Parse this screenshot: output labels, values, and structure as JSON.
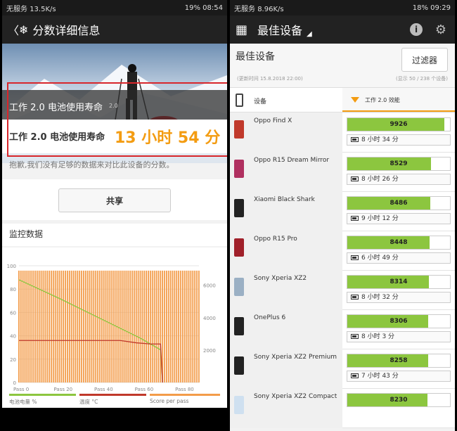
{
  "left": {
    "status": {
      "carrier": "无服务 ",
      "speed": "13.5K/s",
      "battery": "19%",
      "time": "08:54"
    },
    "appbar": {
      "back": "〈",
      "title": "分数详细信息"
    },
    "band1": {
      "label": "工作 2.0 电池使用寿命",
      "version": "2.0"
    },
    "band2": {
      "label": "工作 2.0 电池使用寿命",
      "value": "13 小时 54 分"
    },
    "sorry": "抱歉,我们没有足够的数据来对比此设备的分数。",
    "share_label": "共享",
    "monitor_title": "监控数据",
    "legend": [
      "电池电量 %",
      "温度 °C",
      "Score per pass"
    ]
  },
  "chart_data": {
    "type": "line",
    "title": "",
    "x_ticks": [
      "Pass 0",
      "Pass 20",
      "Pass 40",
      "Pass 60",
      "Pass 80"
    ],
    "y_left_ticks": [
      100,
      80,
      60,
      40,
      20,
      0
    ],
    "y_right_ticks": [
      6000,
      4000,
      2000
    ],
    "ylim_left": [
      0,
      100
    ],
    "ylim_right": [
      0,
      7200
    ],
    "xlim": [
      0,
      89
    ],
    "series": [
      {
        "name": "电池电量 %",
        "color": "#8cc63f",
        "values": [
          [
            0,
            88
          ],
          [
            20,
            72
          ],
          [
            40,
            55
          ],
          [
            60,
            38
          ],
          [
            70,
            28
          ],
          [
            71,
            0
          ]
        ]
      },
      {
        "name": "温度 °C",
        "color": "#c0392b",
        "values": [
          [
            0,
            36
          ],
          [
            20,
            36
          ],
          [
            30,
            36
          ],
          [
            40,
            36
          ],
          [
            50,
            36
          ],
          [
            58,
            34
          ],
          [
            65,
            33
          ],
          [
            70,
            33
          ],
          [
            71,
            0
          ]
        ]
      },
      {
        "name": "Score per pass",
        "color": "#f39c4a",
        "values": [
          [
            0,
            6900
          ],
          [
            89,
            6900
          ]
        ]
      }
    ],
    "grid": true
  },
  "right": {
    "status": {
      "carrier": "无服务 ",
      "speed": "8.96K/s",
      "battery": "18%",
      "time": "09:29"
    },
    "appbar": {
      "title": "最佳设备"
    },
    "section_title": "最佳设备",
    "updated": "(更新时间 15.8.2018 22:00)",
    "count": "(显示 50 / 238 个设备)",
    "filter_label": "过滤器",
    "col_device": "设备",
    "col_score": "工作 2.0 效能",
    "devices": [
      {
        "name": "Oppo Find X",
        "score": 9926,
        "score_text": "9926",
        "life": "8 小时 34 分",
        "color": "#c0392b"
      },
      {
        "name": "Oppo R15 Dream Mirror",
        "score": 8529,
        "score_text": "8529",
        "life": "8 小时 26 分",
        "color": "#b03060"
      },
      {
        "name": "Xiaomi Black Shark",
        "score": 8486,
        "score_text": "8486",
        "life": "9 小时 12 分",
        "color": "#222222"
      },
      {
        "name": "Oppo R15 Pro",
        "score": 8448,
        "score_text": "8448",
        "life": "6 小时 49 分",
        "color": "#a0202a"
      },
      {
        "name": "Sony Xperia XZ2",
        "score": 8314,
        "score_text": "8314",
        "life": "8 小时 32 分",
        "color": "#9bb0c4"
      },
      {
        "name": "OnePlus 6",
        "score": 8306,
        "score_text": "8306",
        "life": "8 小时 3 分",
        "color": "#222222"
      },
      {
        "name": "Sony Xperia XZ2 Premium",
        "score": 8258,
        "score_text": "8258",
        "life": "7 小时 43 分",
        "color": "#222222"
      },
      {
        "name": "Sony Xperia XZ2 Compact",
        "score": 8230,
        "score_text": "8230",
        "life": "",
        "color": "#cfe0f0"
      }
    ]
  }
}
